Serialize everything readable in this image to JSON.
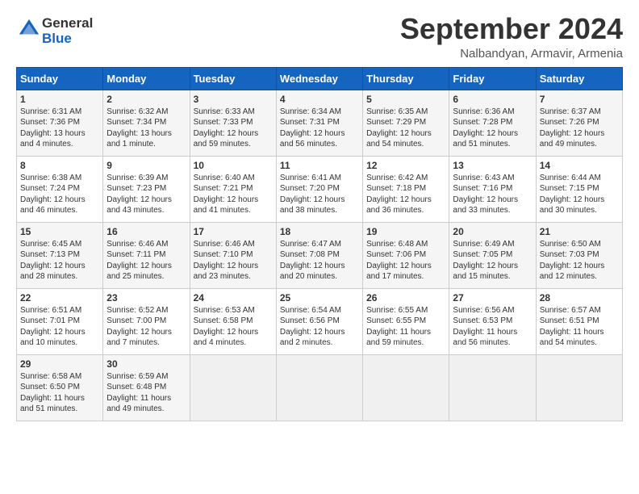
{
  "header": {
    "logo": {
      "general": "General",
      "blue": "Blue"
    },
    "title": "September 2024",
    "location": "Nalbandyan, Armavir, Armenia"
  },
  "columns": [
    "Sunday",
    "Monday",
    "Tuesday",
    "Wednesday",
    "Thursday",
    "Friday",
    "Saturday"
  ],
  "weeks": [
    [
      {
        "day": "1",
        "info": "Sunrise: 6:31 AM\nSunset: 7:36 PM\nDaylight: 13 hours\nand 4 minutes."
      },
      {
        "day": "2",
        "info": "Sunrise: 6:32 AM\nSunset: 7:34 PM\nDaylight: 13 hours\nand 1 minute."
      },
      {
        "day": "3",
        "info": "Sunrise: 6:33 AM\nSunset: 7:33 PM\nDaylight: 12 hours\nand 59 minutes."
      },
      {
        "day": "4",
        "info": "Sunrise: 6:34 AM\nSunset: 7:31 PM\nDaylight: 12 hours\nand 56 minutes."
      },
      {
        "day": "5",
        "info": "Sunrise: 6:35 AM\nSunset: 7:29 PM\nDaylight: 12 hours\nand 54 minutes."
      },
      {
        "day": "6",
        "info": "Sunrise: 6:36 AM\nSunset: 7:28 PM\nDaylight: 12 hours\nand 51 minutes."
      },
      {
        "day": "7",
        "info": "Sunrise: 6:37 AM\nSunset: 7:26 PM\nDaylight: 12 hours\nand 49 minutes."
      }
    ],
    [
      {
        "day": "8",
        "info": "Sunrise: 6:38 AM\nSunset: 7:24 PM\nDaylight: 12 hours\nand 46 minutes."
      },
      {
        "day": "9",
        "info": "Sunrise: 6:39 AM\nSunset: 7:23 PM\nDaylight: 12 hours\nand 43 minutes."
      },
      {
        "day": "10",
        "info": "Sunrise: 6:40 AM\nSunset: 7:21 PM\nDaylight: 12 hours\nand 41 minutes."
      },
      {
        "day": "11",
        "info": "Sunrise: 6:41 AM\nSunset: 7:20 PM\nDaylight: 12 hours\nand 38 minutes."
      },
      {
        "day": "12",
        "info": "Sunrise: 6:42 AM\nSunset: 7:18 PM\nDaylight: 12 hours\nand 36 minutes."
      },
      {
        "day": "13",
        "info": "Sunrise: 6:43 AM\nSunset: 7:16 PM\nDaylight: 12 hours\nand 33 minutes."
      },
      {
        "day": "14",
        "info": "Sunrise: 6:44 AM\nSunset: 7:15 PM\nDaylight: 12 hours\nand 30 minutes."
      }
    ],
    [
      {
        "day": "15",
        "info": "Sunrise: 6:45 AM\nSunset: 7:13 PM\nDaylight: 12 hours\nand 28 minutes."
      },
      {
        "day": "16",
        "info": "Sunrise: 6:46 AM\nSunset: 7:11 PM\nDaylight: 12 hours\nand 25 minutes."
      },
      {
        "day": "17",
        "info": "Sunrise: 6:46 AM\nSunset: 7:10 PM\nDaylight: 12 hours\nand 23 minutes."
      },
      {
        "day": "18",
        "info": "Sunrise: 6:47 AM\nSunset: 7:08 PM\nDaylight: 12 hours\nand 20 minutes."
      },
      {
        "day": "19",
        "info": "Sunrise: 6:48 AM\nSunset: 7:06 PM\nDaylight: 12 hours\nand 17 minutes."
      },
      {
        "day": "20",
        "info": "Sunrise: 6:49 AM\nSunset: 7:05 PM\nDaylight: 12 hours\nand 15 minutes."
      },
      {
        "day": "21",
        "info": "Sunrise: 6:50 AM\nSunset: 7:03 PM\nDaylight: 12 hours\nand 12 minutes."
      }
    ],
    [
      {
        "day": "22",
        "info": "Sunrise: 6:51 AM\nSunset: 7:01 PM\nDaylight: 12 hours\nand 10 minutes."
      },
      {
        "day": "23",
        "info": "Sunrise: 6:52 AM\nSunset: 7:00 PM\nDaylight: 12 hours\nand 7 minutes."
      },
      {
        "day": "24",
        "info": "Sunrise: 6:53 AM\nSunset: 6:58 PM\nDaylight: 12 hours\nand 4 minutes."
      },
      {
        "day": "25",
        "info": "Sunrise: 6:54 AM\nSunset: 6:56 PM\nDaylight: 12 hours\nand 2 minutes."
      },
      {
        "day": "26",
        "info": "Sunrise: 6:55 AM\nSunset: 6:55 PM\nDaylight: 11 hours\nand 59 minutes."
      },
      {
        "day": "27",
        "info": "Sunrise: 6:56 AM\nSunset: 6:53 PM\nDaylight: 11 hours\nand 56 minutes."
      },
      {
        "day": "28",
        "info": "Sunrise: 6:57 AM\nSunset: 6:51 PM\nDaylight: 11 hours\nand 54 minutes."
      }
    ],
    [
      {
        "day": "29",
        "info": "Sunrise: 6:58 AM\nSunset: 6:50 PM\nDaylight: 11 hours\nand 51 minutes."
      },
      {
        "day": "30",
        "info": "Sunrise: 6:59 AM\nSunset: 6:48 PM\nDaylight: 11 hours\nand 49 minutes."
      },
      {
        "day": "",
        "info": ""
      },
      {
        "day": "",
        "info": ""
      },
      {
        "day": "",
        "info": ""
      },
      {
        "day": "",
        "info": ""
      },
      {
        "day": "",
        "info": ""
      }
    ]
  ]
}
